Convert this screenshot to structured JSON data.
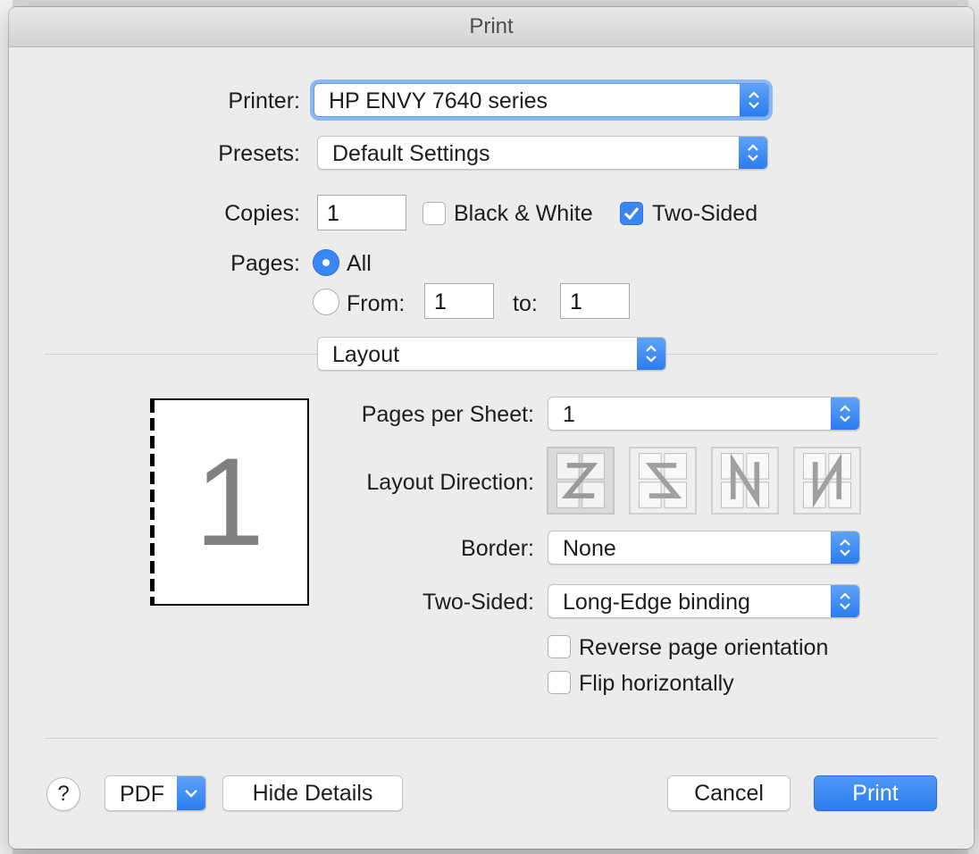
{
  "window": {
    "title": "Print"
  },
  "printer": {
    "label": "Printer:",
    "value": "HP ENVY 7640 series"
  },
  "presets": {
    "label": "Presets:",
    "value": "Default Settings"
  },
  "copies": {
    "label": "Copies:",
    "value": "1",
    "black_white": {
      "label": "Black & White",
      "checked": false
    },
    "two_sided": {
      "label": "Two-Sided",
      "checked": true
    }
  },
  "pages": {
    "label": "Pages:",
    "all_label": "All",
    "all_selected": true,
    "from_label": "From:",
    "from_value": "1",
    "to_label": "to:",
    "to_value": "1"
  },
  "section": {
    "value": "Layout"
  },
  "preview": {
    "page_number": "1"
  },
  "layout": {
    "pages_per_sheet": {
      "label": "Pages per Sheet:",
      "value": "1"
    },
    "layout_direction": {
      "label": "Layout Direction:",
      "options": [
        "Z",
        "reverse-Z",
        "reverse-N",
        "N"
      ],
      "selected": "Z"
    },
    "border": {
      "label": "Border:",
      "value": "None"
    },
    "two_sided": {
      "label": "Two-Sided:",
      "value": "Long-Edge binding"
    },
    "reverse_orientation": {
      "label": "Reverse page orientation",
      "checked": false
    },
    "flip_horizontally": {
      "label": "Flip horizontally",
      "checked": false
    }
  },
  "footer": {
    "help": "?",
    "pdf": "PDF",
    "hide_details": "Hide Details",
    "cancel": "Cancel",
    "print": "Print"
  },
  "colors": {
    "accent": "#2c7cf0",
    "dialog_bg": "#ececec"
  }
}
